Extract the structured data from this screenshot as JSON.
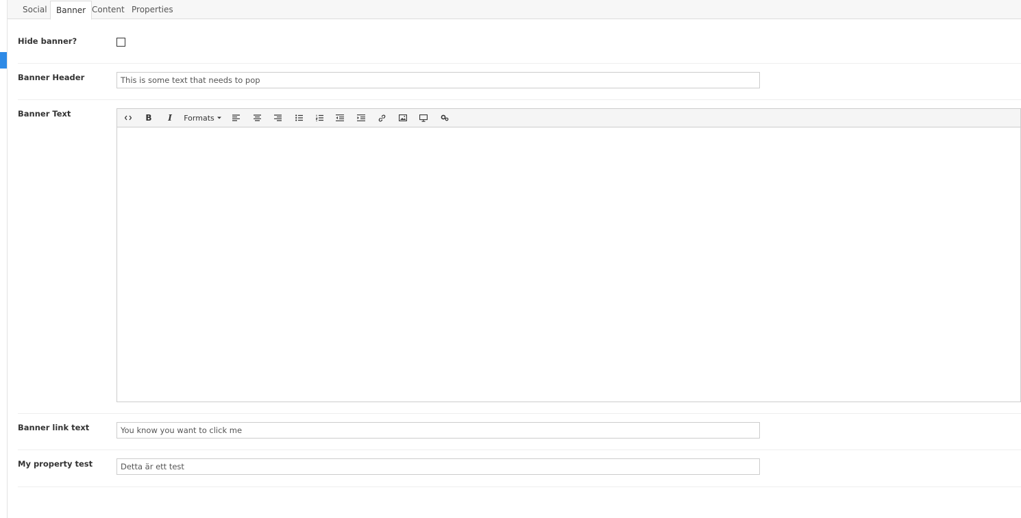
{
  "tabs": [
    {
      "label": "Social",
      "active": false
    },
    {
      "label": "Banner",
      "active": true
    },
    {
      "label": "Content",
      "active": false
    },
    {
      "label": "Properties",
      "active": false
    }
  ],
  "form": {
    "hide_banner": {
      "label": "Hide banner?",
      "checked": false
    },
    "banner_header": {
      "label": "Banner Header",
      "value": "This is some text that needs to pop"
    },
    "banner_text": {
      "label": "Banner Text",
      "toolbar": {
        "formats_label": "Formats",
        "buttons": [
          "code-icon",
          "bold-icon",
          "italic-icon",
          "formats-dropdown",
          "align-left-icon",
          "align-center-icon",
          "align-right-icon",
          "bullet-list-icon",
          "numbered-list-icon",
          "outdent-icon",
          "indent-icon",
          "link-icon",
          "image-icon",
          "embed-icon",
          "macro-icon"
        ]
      },
      "value": ""
    },
    "banner_link_text": {
      "label": "Banner link text",
      "value": "You know you want to click me"
    },
    "my_property_test": {
      "label": "My property test",
      "value": "Detta är ett test"
    }
  },
  "colors": {
    "accent": "#2e8ae6",
    "border": "#cccccc",
    "tab_bg": "#f7f7f7"
  }
}
